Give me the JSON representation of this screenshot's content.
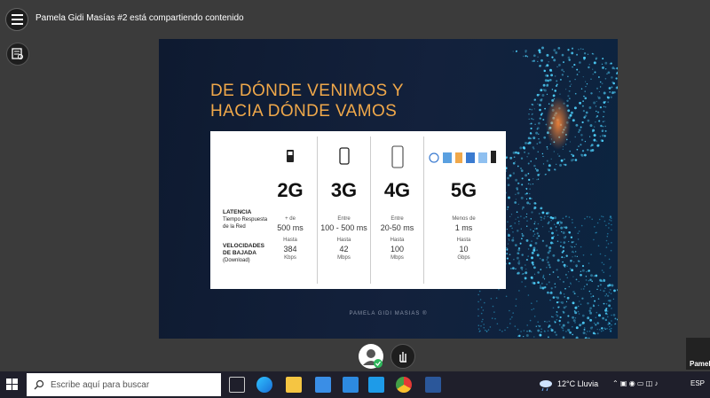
{
  "meeting": {
    "sharer_text": "Pamela Gidi Masías #2 está compartiendo contenido",
    "participant_tile_label": "Pamel"
  },
  "slide": {
    "title_lines": [
      "DE DÓNDE VENIMOS Y",
      "HACIA DÓNDE VAMOS"
    ],
    "row_labels": {
      "latency": "LATENCIA",
      "latency_sub": [
        "Tiempo Respuesta",
        "de la Red"
      ],
      "speed": [
        "VELOCIDADES",
        "DE BAJADA"
      ],
      "speed_sub": "(Download)"
    },
    "columns": [
      {
        "gen": "2G",
        "latency_prefix": "+ de",
        "latency": "500 ms",
        "speed_prefix": "Hasta",
        "speed": "384",
        "speed_unit": "Kbps"
      },
      {
        "gen": "3G",
        "latency_prefix": "Entre",
        "latency": "100 - 500 ms",
        "speed_prefix": "Hasta",
        "speed": "42",
        "speed_unit": "Mbps"
      },
      {
        "gen": "4G",
        "latency_prefix": "Entre",
        "latency": "20-50 ms",
        "speed_prefix": "Hasta",
        "speed": "100",
        "speed_unit": "Mbps"
      },
      {
        "gen": "5G",
        "latency_prefix": "Menos de",
        "latency": "1 ms",
        "speed_prefix": "Hasta",
        "speed": "10",
        "speed_unit": "Gbps"
      }
    ],
    "footer": "PAMELA GIDI MASIAS ®"
  },
  "taskbar": {
    "search_placeholder": "Escribe aquí para buscar",
    "weather": "12°C  Lluvia",
    "language": "ESP"
  },
  "colors": {
    "accent_title": "#f0a84a",
    "slide_bg": "#13213c",
    "taskbar_bg": "#1f1f2b"
  }
}
